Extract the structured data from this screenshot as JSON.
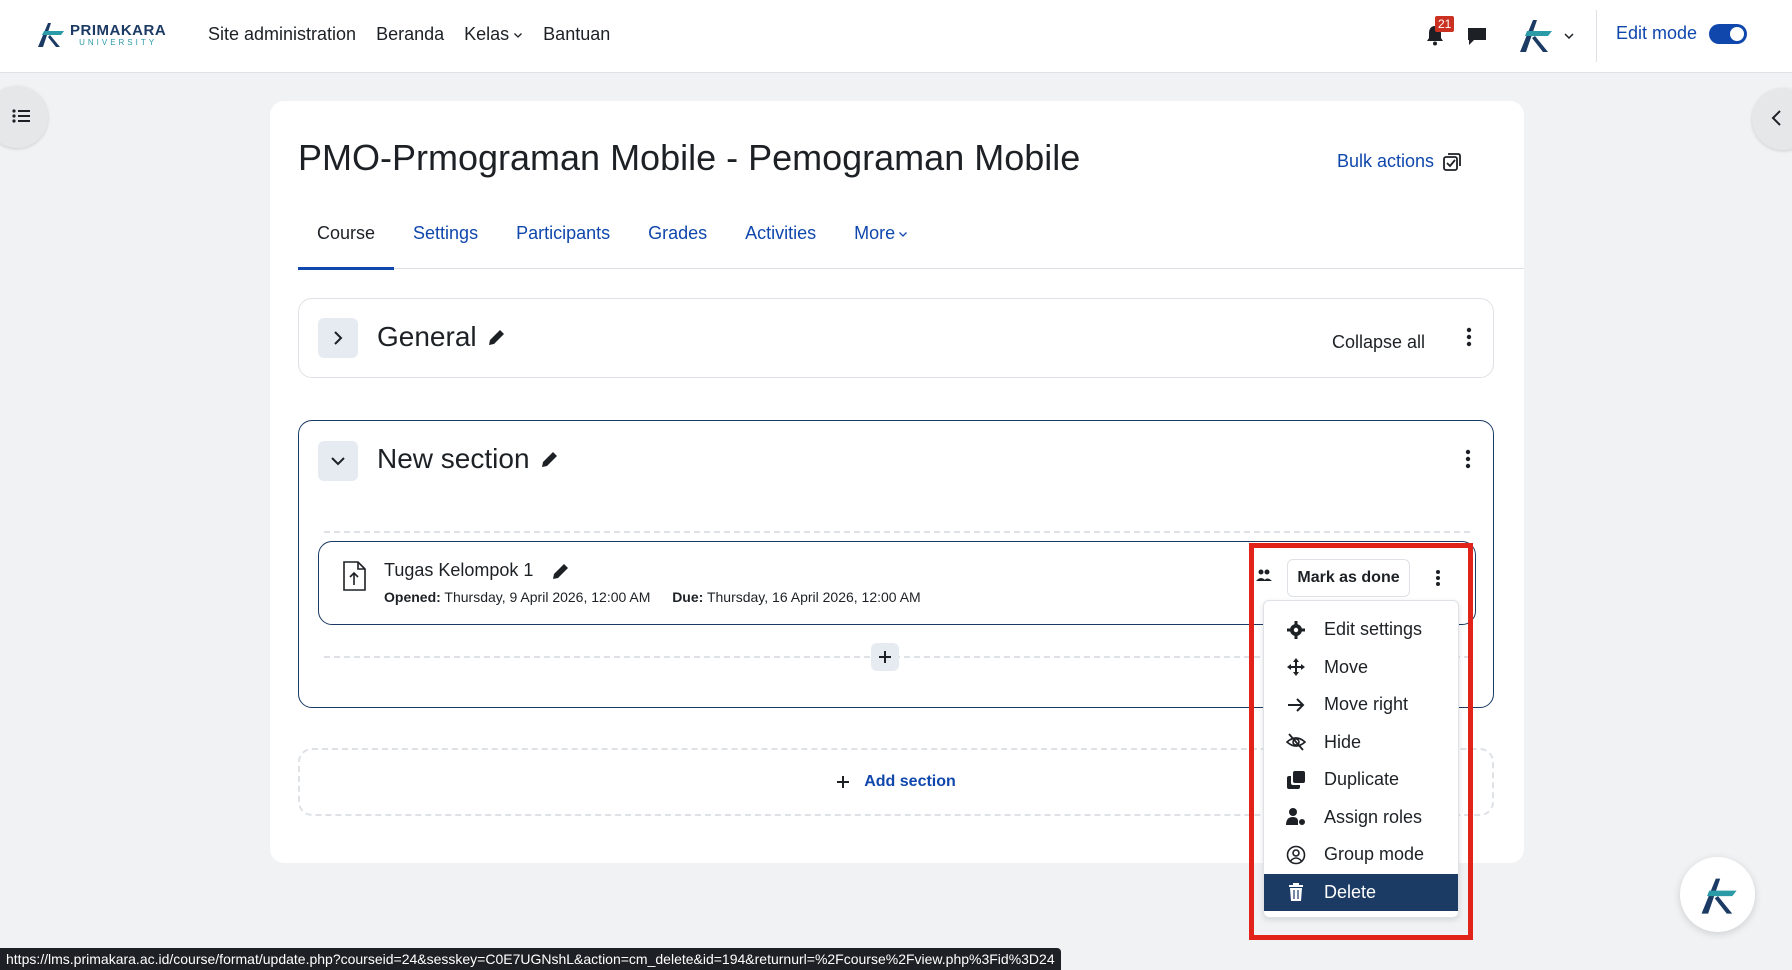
{
  "brand": {
    "name": "PRIMAKARA",
    "sub": "UNIVERSITY"
  },
  "nav": {
    "items": [
      {
        "label": "Site administration"
      },
      {
        "label": "Beranda"
      },
      {
        "label": "Kelas"
      },
      {
        "label": "Bantuan"
      }
    ],
    "notification_count": "21",
    "edit_mode_label": "Edit mode",
    "edit_mode_on": true
  },
  "course": {
    "title": "PMO-Prmograman Mobile - Pemograman Mobile",
    "bulk_actions": "Bulk actions",
    "tabs": [
      {
        "label": "Course",
        "active": true
      },
      {
        "label": "Settings"
      },
      {
        "label": "Participants"
      },
      {
        "label": "Grades"
      },
      {
        "label": "Activities"
      },
      {
        "label": "More"
      }
    ]
  },
  "sections": {
    "general": {
      "name": "General",
      "collapse_all": "Collapse all"
    },
    "new": {
      "name": "New section",
      "activity": {
        "name": "Tugas Kelompok 1",
        "opened_label": "Opened:",
        "opened_value": "Thursday, 9 April 2026, 12:00 AM",
        "due_label": "Due:",
        "due_value": "Thursday, 16 April 2026, 12:00 AM",
        "mark_done": "Mark as done"
      }
    },
    "add_section": "Add section"
  },
  "menu": {
    "items": [
      {
        "label": "Edit settings",
        "icon": "gear-icon"
      },
      {
        "label": "Move",
        "icon": "move-icon"
      },
      {
        "label": "Move right",
        "icon": "arrow-right-icon"
      },
      {
        "label": "Hide",
        "icon": "eye-slash-icon"
      },
      {
        "label": "Duplicate",
        "icon": "duplicate-icon"
      },
      {
        "label": "Assign roles",
        "icon": "user-roles-icon"
      },
      {
        "label": "Group mode",
        "icon": "group-mode-icon"
      },
      {
        "label": "Delete",
        "icon": "trash-icon",
        "active": true
      }
    ]
  },
  "status_url": "https://lms.primakara.ac.id/course/format/update.php?courseid=24&sesskey=C0E7UGNshL&action=cm_delete&id=194&returnurl=%2Fcourse%2Fview.php%3Fid%3D24",
  "colors": {
    "primary": "#0f47ad",
    "navy": "#1b3a64",
    "highlight": "#e2231a",
    "badge": "#ca3120"
  }
}
